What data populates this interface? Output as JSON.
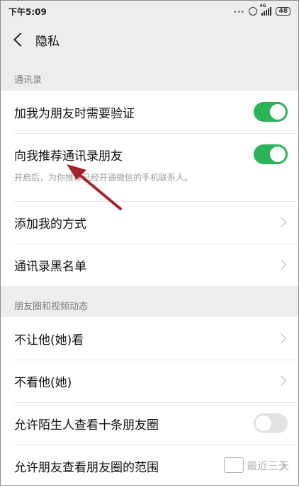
{
  "status_bar": {
    "time": "下午5:09",
    "signal_tag": "4G",
    "battery": "48"
  },
  "nav": {
    "title": "隐私"
  },
  "sections": [
    {
      "header": "通讯录",
      "rows": [
        {
          "label": "加我为朋友时需要验证",
          "control": "toggle",
          "state": "on"
        },
        {
          "label": "向我推荐通讯录朋友",
          "control": "toggle",
          "state": "on",
          "description": "开启后，为你推荐已经开通微信的手机联系人。"
        },
        {
          "label": "添加我的方式",
          "control": "chevron"
        },
        {
          "label": "通讯录黑名单",
          "control": "chevron"
        }
      ]
    },
    {
      "header": "朋友圈和视频动态",
      "rows": [
        {
          "label": "不让他(她)看",
          "control": "chevron"
        },
        {
          "label": "不看他(她)",
          "control": "chevron"
        },
        {
          "label": "允许陌生人查看十条朋友圈",
          "control": "toggle",
          "state": "off"
        },
        {
          "label": "允许朋友查看朋友圈的范围",
          "control": "chevron"
        }
      ]
    }
  ],
  "watermark": {
    "text": "最近三天"
  },
  "colors": {
    "toggle_on": "#2bb35a",
    "toggle_off": "#e2e2e2",
    "annotation_arrow": "#a3232b"
  }
}
